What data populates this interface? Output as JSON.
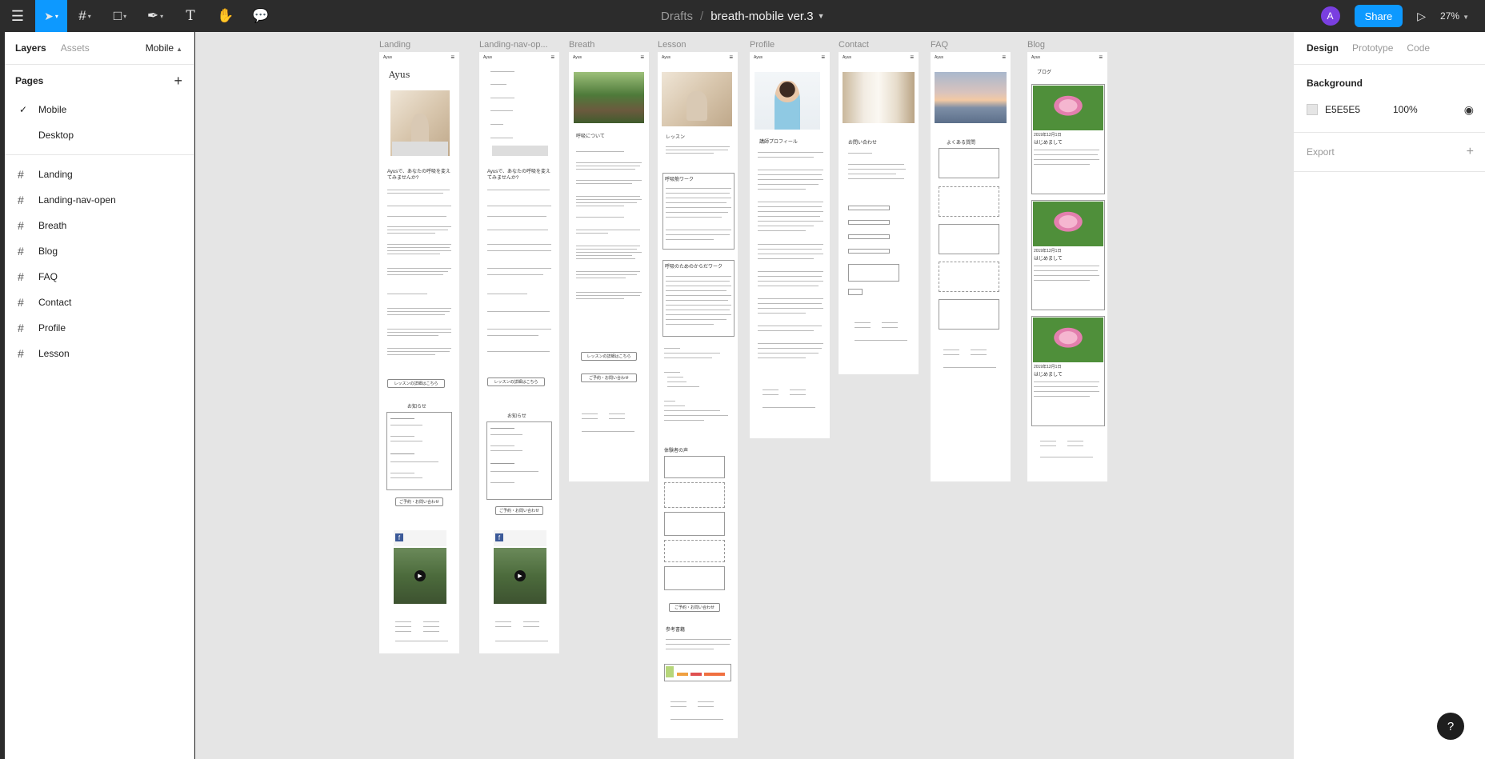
{
  "toolbar": {
    "breadcrumb_parent": "Drafts",
    "breadcrumb_sep": "/",
    "file_name": "breath-mobile ver.3",
    "avatar_initial": "A",
    "share_label": "Share",
    "zoom_level": "27%"
  },
  "left_panel": {
    "tab_layers": "Layers",
    "tab_assets": "Assets",
    "current_page": "Mobile",
    "pages_title": "Pages",
    "pages": [
      {
        "name": "Mobile",
        "selected": true
      },
      {
        "name": "Desktop",
        "selected": false
      }
    ],
    "layers": [
      "Landing",
      "Landing-nav-open",
      "Breath",
      "Blog",
      "FAQ",
      "Contact",
      "Profile",
      "Lesson"
    ]
  },
  "right_panel": {
    "tab_design": "Design",
    "tab_prototype": "Prototype",
    "tab_code": "Code",
    "background_title": "Background",
    "background_hex": "E5E5E5",
    "background_opacity": "100%",
    "export_title": "Export"
  },
  "canvas": {
    "frames": [
      {
        "label": "Landing"
      },
      {
        "label": "Landing-nav-op..."
      },
      {
        "label": "Breath"
      },
      {
        "label": "Lesson"
      },
      {
        "label": "Profile"
      },
      {
        "label": "Contact"
      },
      {
        "label": "FAQ"
      },
      {
        "label": "Blog"
      }
    ],
    "logo_text": "Ayus",
    "landing_hero_title": "Ayus",
    "landing_tagline": "Ayusで、あなたの呼吸を変えてみませんか?",
    "landing_news_title": "お知らせ",
    "landing_lesson_btn": "レッスンの詳細はこちら",
    "landing_contact_btn": "ご予約・お問い合わせ",
    "breath_title": "呼吸について",
    "lesson_title": "レッスン",
    "lesson_work1": "呼吸筋ワーク",
    "lesson_work2": "呼吸のためのからだワーク",
    "lesson_voice": "体験者の声",
    "lesson_books": "参考書籍",
    "profile_title": "講師プロフィール",
    "contact_title": "お問い合わせ",
    "faq_title": "よくある質問",
    "blog_title": "ブログ",
    "blog_post_title": "はじめまして",
    "blog_dates": [
      "2019年12月1日",
      "2019年12月1日",
      "2019年12月1日"
    ]
  },
  "colors": {
    "accent": "#0d99ff",
    "canvas_bg": "#e5e5e5",
    "chrome_bg": "#2c2c2c"
  }
}
